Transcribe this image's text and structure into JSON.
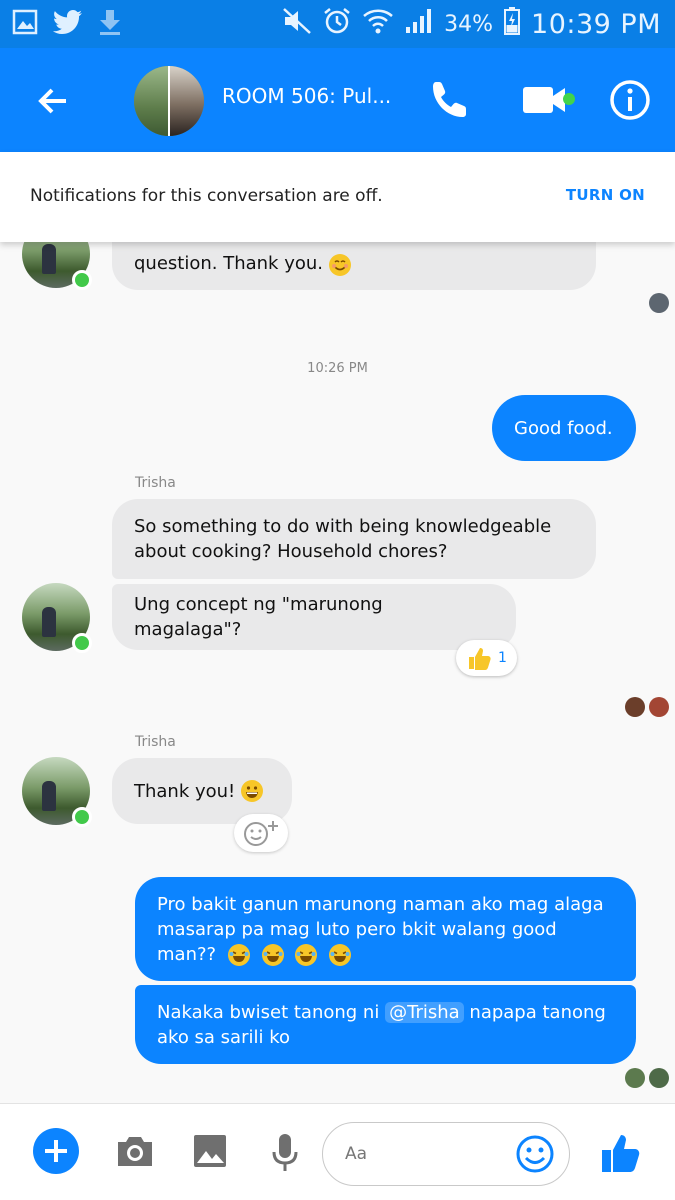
{
  "status_bar": {
    "battery_percent": "34%",
    "time": "10:39 PM",
    "left_icons": [
      "gallery-icon",
      "twitter-icon",
      "download-icon"
    ],
    "right_icons": [
      "mute-icon",
      "alarm-icon",
      "wifi-icon",
      "signal-icon",
      "battery-icon"
    ]
  },
  "header": {
    "title": "ROOM 506: Pul...",
    "call_icon": "phone-icon",
    "video_icon": "video-camera-icon",
    "info_icon": "info-icon",
    "accent": "#0c84ff"
  },
  "notification": {
    "text": "Notifications for this conversation are off.",
    "action": "TURN ON"
  },
  "messages": {
    "partial_text": "question. Thank you.",
    "time_label": "10:26 PM",
    "sent_1": "Good food.",
    "sender_1": "Trisha",
    "received_1": "So something to do with being knowledgeable about cooking? Household chores?",
    "received_2": "Ung concept ng \"marunong magalaga\"?",
    "reaction_count": "1",
    "sender_2": "Trisha",
    "received_3": "Thank you!",
    "sent_2": "Pro bakit ganun marunong naman ako mag alaga masarap pa mag luto pero bkit walang good man??",
    "sent_3_prefix": "Nakaka bwiset tanong ni",
    "sent_3_mention": "@Trisha",
    "sent_3_suffix": "napapa tanong ako sa sarili ko"
  },
  "composer": {
    "placeholder": "Aa"
  },
  "colors": {
    "outgoing_bubble": "#0c84ff",
    "incoming_bubble": "#e9e9ea",
    "online": "#42c94a"
  }
}
